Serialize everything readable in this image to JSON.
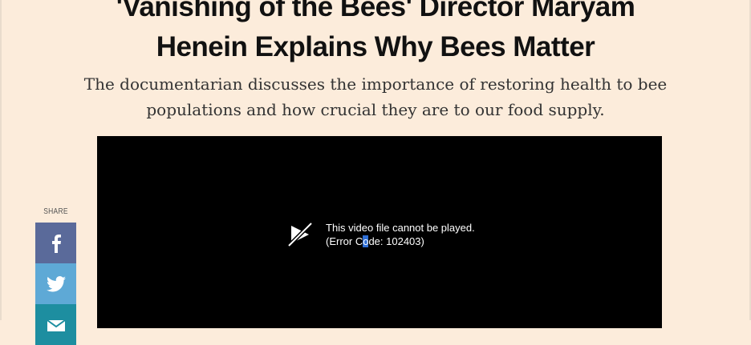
{
  "article": {
    "headline_line1": "'Vanishing of the Bees' Director Maryam",
    "headline_line2": "Henein Explains Why Bees Matter",
    "dek_line1": "The documentarian discusses the importance of restoring health to bee",
    "dek_line2": "populations and how crucial they are to our food supply."
  },
  "video": {
    "error_message": "This video file cannot be played.",
    "error_code_prefix": "(Error C",
    "error_code_selected": "o",
    "error_code_suffix": "de: 102403)",
    "icon": "broken-play-icon"
  },
  "share": {
    "label": "SHARE",
    "buttons": [
      {
        "network": "facebook",
        "icon": "facebook-icon",
        "color": "#5a6a9a"
      },
      {
        "network": "twitter",
        "icon": "twitter-icon",
        "color": "#5ea9d6"
      },
      {
        "network": "email",
        "icon": "email-icon",
        "color": "#1d8ea0"
      }
    ]
  }
}
